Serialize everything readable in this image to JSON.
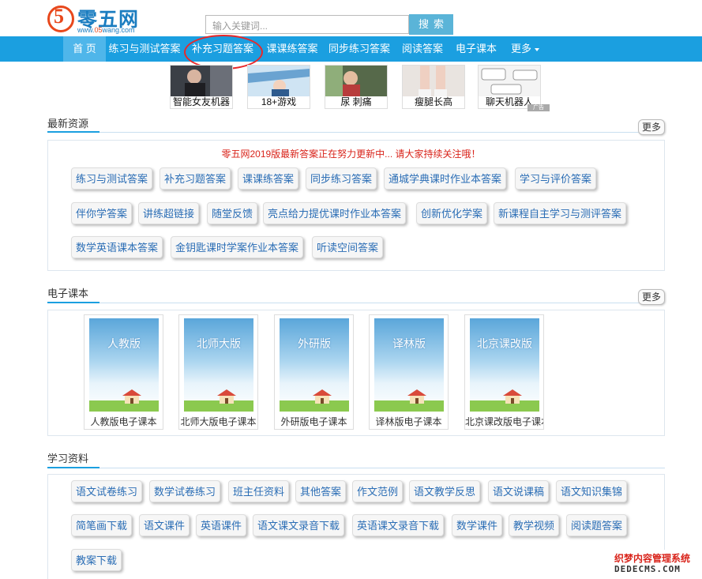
{
  "header": {
    "logo_text": "零五网",
    "logo_num": "5",
    "logo_url_a": "www.",
    "logo_url_b": "05",
    "logo_url_c": "wang.com",
    "search_placeholder": "输入关键词...",
    "search_button": "搜索"
  },
  "nav": {
    "items": [
      {
        "label": "首 页"
      },
      {
        "label": "练习与测试答案"
      },
      {
        "label": "补充习题答案"
      },
      {
        "label": "课课练答案"
      },
      {
        "label": "同步练习答案"
      },
      {
        "label": "阅读答案"
      },
      {
        "label": "电子课本"
      },
      {
        "label": "更多"
      }
    ]
  },
  "ads": [
    {
      "caption": "智能女友机器"
    },
    {
      "caption": "18+游戏"
    },
    {
      "caption": "尿 刺痛"
    },
    {
      "caption": "瘦腿长高"
    },
    {
      "caption": "聊天机器人"
    }
  ],
  "ad_badge": "广告",
  "latest": {
    "title": "最新资源",
    "more": "更多",
    "notice": "零五网2019版最新答案正在努力更新中... 请大家持续关注哦！",
    "tags": [
      "练习与测试答案",
      "补充习题答案",
      "课课练答案",
      "同步练习答案",
      "通城学典课时作业本答案",
      "学习与评价答案",
      "伴你学答案",
      "讲练超链接",
      "随堂反馈",
      "亮点给力提优课时作业本答案",
      "创新优化学案",
      "新课程自主学习与测评答案",
      "数学英语课本答案",
      "金钥匙课时学案作业本答案",
      "听读空间答案"
    ]
  },
  "ebooks": {
    "title": "电子课本",
    "more": "更多",
    "books": [
      {
        "cover": "人教版",
        "caption": "人教版电子课本"
      },
      {
        "cover": "北师大版",
        "caption": "北师大版电子课本"
      },
      {
        "cover": "外研版",
        "caption": "外研版电子课本"
      },
      {
        "cover": "译林版",
        "caption": "译林版电子课本"
      },
      {
        "cover": "北京课改版",
        "caption": "北京课改版电子课本"
      }
    ]
  },
  "study": {
    "title": "学习资料",
    "tags": [
      "语文试卷练习",
      "数学试卷练习",
      "班主任资料",
      "其他答案",
      "作文范例",
      "语文教学反思",
      "语文说课稿",
      "语文知识集锦",
      "简笔画下载",
      "语文课件",
      "英语课件",
      "语文课文录音下载",
      "英语课文录音下载",
      "数学课件",
      "教学视频",
      "阅读题答案",
      "教案下载"
    ]
  },
  "watermark": {
    "line1": "织梦内容管理系统",
    "line2": "DEDECMS.COM"
  },
  "colors": {
    "nav_bg": "#1b9fe0",
    "tag_text": "#2a6db5",
    "notice": "#d9241b",
    "annotation": "#e8282a"
  }
}
